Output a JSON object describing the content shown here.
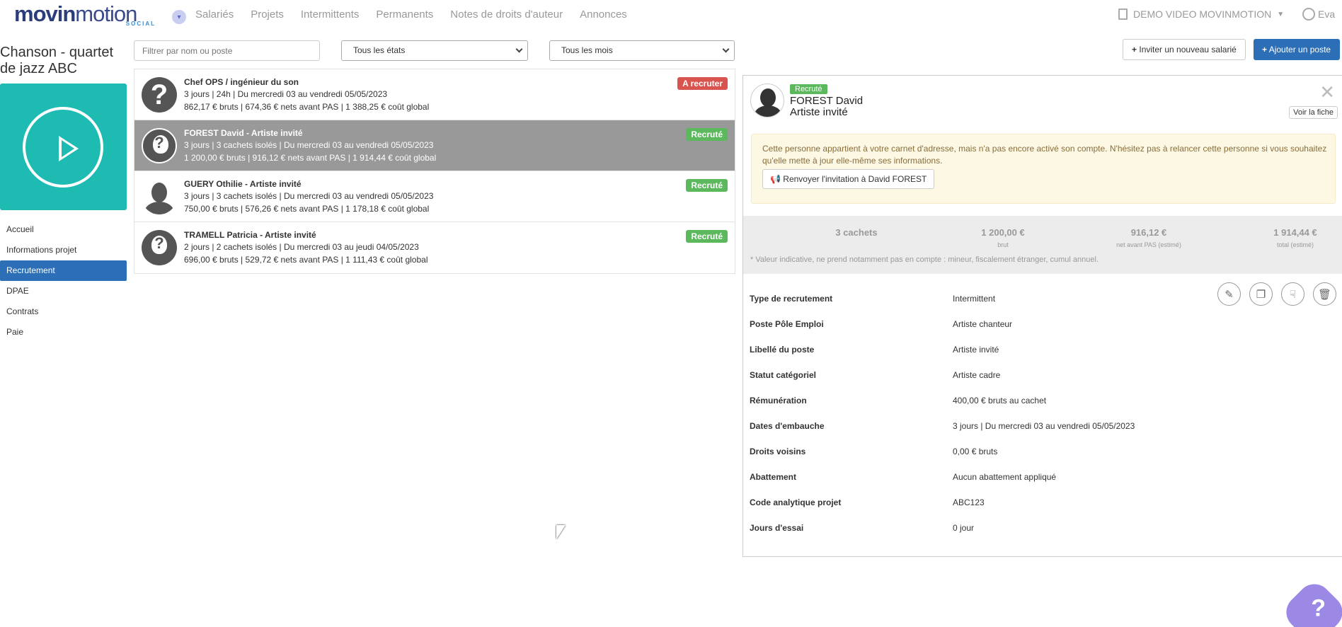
{
  "app": {
    "logo_main_bold": "movin",
    "logo_main_light": "motion",
    "logo_sub": "SOCIAL"
  },
  "nav": {
    "links": [
      "Salariés",
      "Projets",
      "Intermittents",
      "Permanents",
      "Notes de droits d'auteur",
      "Annonces"
    ],
    "org": "DEMO VIDEO MOVINMOTION",
    "user": "Eva"
  },
  "project": {
    "title": "Chanson - quartet de jazz ABC",
    "tile_color": "#1ebbb3"
  },
  "sidebar": {
    "items": [
      "Accueil",
      "Informations projet",
      "Recrutement",
      "DPAE",
      "Contrats",
      "Paie"
    ],
    "active": "Recrutement"
  },
  "filters": {
    "search_placeholder": "Filtrer par nom ou poste",
    "state": "Tous les états",
    "month": "Tous les mois"
  },
  "toolbar": {
    "invite": "Inviter un nouveau salarié",
    "add": "Ajouter un poste"
  },
  "list": {
    "rows": [
      {
        "name": "Chef OPS / ingénieur du son",
        "line1": "3 jours | 24h | Du mercredi 03 au vendredi 05/05/2023",
        "line2": "862,17 € bruts | 674,36 € nets avant PAS | 1 388,25 € coût global",
        "badge": "A recruter"
      },
      {
        "name": "FOREST David - Artiste invité",
        "line1": "3 jours | 3 cachets isolés | Du mercredi 03 au vendredi 05/05/2023",
        "line2": "1 200,00 € bruts | 916,12 € nets avant PAS | 1 914,44 € coût global",
        "badge": "Recruté"
      },
      {
        "name": "GUERY Othilie - Artiste invité",
        "line1": "3 jours | 3 cachets isolés | Du mercredi 03 au vendredi 05/05/2023",
        "line2": "750,00 € bruts | 576,26 € nets avant PAS | 1 178,18 € coût global",
        "badge": "Recruté"
      },
      {
        "name": "TRAMELL Patricia - Artiste invité",
        "line1": "2 jours | 2 cachets isolés | Du mercredi 03 au jeudi 04/05/2023",
        "line2": "696,00 € bruts | 529,72 € nets avant PAS | 1 111,43 € coût global",
        "badge": "Recruté"
      }
    ]
  },
  "detail": {
    "badge": "Recruté",
    "name": "FOREST David",
    "role": "Artiste invité",
    "view_button": "Voir la fiche",
    "notice": "Cette personne appartient à votre carnet d'adresse, mais n'a pas encore activé son compte. N'hésitez pas à relancer cette personne si vous souhaitez qu'elle mette à jour elle-même ses informations.",
    "resend_button": "Renvoyer l'invitation à David FOREST",
    "summary": [
      {
        "value": "3 cachets",
        "label": ""
      },
      {
        "value": "1 200,00 €",
        "label": "brut"
      },
      {
        "value": "916,12 €",
        "label": "net avant PAS (estimé)"
      },
      {
        "value": "1 914,44 €",
        "label": "total (estimé)"
      }
    ],
    "summary_note": "* Valeur indicative, ne prend notamment pas en compte : mineur, fiscalement étranger, cumul annuel.",
    "fields": [
      {
        "key": "Type de recrutement",
        "value": "Intermittent"
      },
      {
        "key": "Poste Pôle Emploi",
        "value": "Artiste chanteur"
      },
      {
        "key": "Libellé du poste",
        "value": "Artiste invité"
      },
      {
        "key": "Statut catégoriel",
        "value": "Artiste cadre"
      },
      {
        "key": "Rémunération",
        "value": "400,00 € bruts au cachet"
      },
      {
        "key": "Dates d'embauche",
        "value": "3 jours | Du mercredi 03 au vendredi 05/05/2023"
      },
      {
        "key": "Droits voisins",
        "value": "0,00 € bruts"
      },
      {
        "key": "Abattement",
        "value": "Aucun abattement appliqué"
      },
      {
        "key": "Code analytique projet",
        "value": "ABC123"
      },
      {
        "key": "Jours d'essai",
        "value": "0 jour"
      }
    ]
  },
  "help": "?"
}
